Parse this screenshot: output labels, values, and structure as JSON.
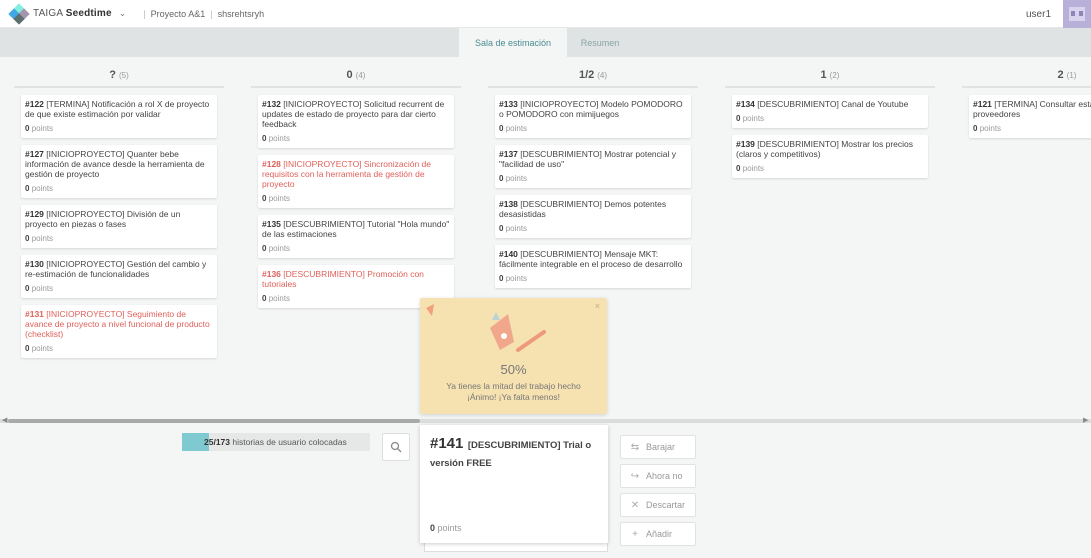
{
  "header": {
    "brand_light": "TAIGA",
    "brand_bold": "Seedtime",
    "breadcrumb": [
      "Proyecto A&1",
      "shsrehtsryh"
    ],
    "user": "user1"
  },
  "tabs": [
    "Sala de estimación",
    "Resumen"
  ],
  "columns": [
    {
      "label": "?",
      "count": "(5)",
      "cards": [
        {
          "ref": "#122",
          "title": "[TERMINA] Notificación a rol X de proyecto de que existe estimación por validar",
          "points": "0",
          "blocked": false
        },
        {
          "ref": "#127",
          "title": "[INICIOPROYECTO] Quanter bebe información de avance desde la herramienta de gestión de proyecto",
          "points": "0",
          "blocked": false
        },
        {
          "ref": "#129",
          "title": "[INICIOPROYECTO] División de un proyecto en piezas o fases",
          "points": "0",
          "blocked": false
        },
        {
          "ref": "#130",
          "title": "[INICIOPROYECTO] Gestión del cambio y re-estimación de funcionalidades",
          "points": "0",
          "blocked": false
        },
        {
          "ref": "#131",
          "title": "[INICIOPROYECTO] Seguimiento de avance de proyecto a nivel funcional de producto (checklist)",
          "points": "0",
          "blocked": true
        }
      ]
    },
    {
      "label": "0",
      "count": "(4)",
      "cards": [
        {
          "ref": "#132",
          "title": "[INICIOPROYECTO] Solicitud recurrent de updates de estado de proyecto para dar cierto feedback",
          "points": "0",
          "blocked": false
        },
        {
          "ref": "#128",
          "title": "[INICIOPROYECTO] Sincronización de requisitos con la herramienta de gestión de proyecto",
          "points": "0",
          "blocked": true
        },
        {
          "ref": "#135",
          "title": "[DESCUBRIMIENTO] Tutorial \"Hola mundo\" de las estimaciones",
          "points": "0",
          "blocked": false
        },
        {
          "ref": "#136",
          "title": "[DESCUBRIMIENTO] Promoción con tutoriales",
          "points": "0",
          "blocked": true
        }
      ]
    },
    {
      "label": "1/2",
      "count": "(4)",
      "cards": [
        {
          "ref": "#133",
          "title": "[INICIOPROYECTO] Modelo POMODORO o POMODORO con mimijuegos",
          "points": "0",
          "blocked": false
        },
        {
          "ref": "#137",
          "title": "[DESCUBRIMIENTO] Mostrar potencial y \"facilidad de uso\"",
          "points": "0",
          "blocked": false
        },
        {
          "ref": "#138",
          "title": "[DESCUBRIMIENTO] Demos potentes desasistidas",
          "points": "0",
          "blocked": false
        },
        {
          "ref": "#140",
          "title": "[DESCUBRIMIENTO] Mensaje MKT: fácilmente integrable en el proceso de desarrollo",
          "points": "0",
          "blocked": false
        }
      ]
    },
    {
      "label": "1",
      "count": "(2)",
      "cards": [
        {
          "ref": "#134",
          "title": "[DESCUBRIMIENTO] Canal de Youtube",
          "points": "0",
          "blocked": false
        },
        {
          "ref": "#139",
          "title": "[DESCUBRIMIENTO] Mostrar los precios (claros y competitivos)",
          "points": "0",
          "blocked": false
        }
      ]
    },
    {
      "label": "2",
      "count": "(1)",
      "cards": [
        {
          "ref": "#121",
          "title": "[TERMINA] Consultar estado de curso de proveedores",
          "points": "0",
          "blocked": false
        }
      ]
    }
  ],
  "points_label": "points",
  "progress": {
    "placed": "25/173",
    "label": "historias de usuario colocadas",
    "fraction": 0.145
  },
  "current_story": {
    "ref": "#141",
    "title": "[DESCUBRIMIENTO] Trial o versión FREE",
    "points": "0"
  },
  "actions": [
    {
      "label": "Barajar",
      "icon": "shuffle-icon"
    },
    {
      "label": "Ahora no",
      "icon": "skip-icon"
    },
    {
      "label": "Descartar",
      "icon": "close-icon"
    },
    {
      "label": "Añadir",
      "icon": "plus-icon"
    }
  ],
  "toast": {
    "percent": "50%",
    "message": "Ya tienes la mitad del trabajo hecho ¡Ánimo! ¡Ya falta menos!",
    "close": "×"
  }
}
